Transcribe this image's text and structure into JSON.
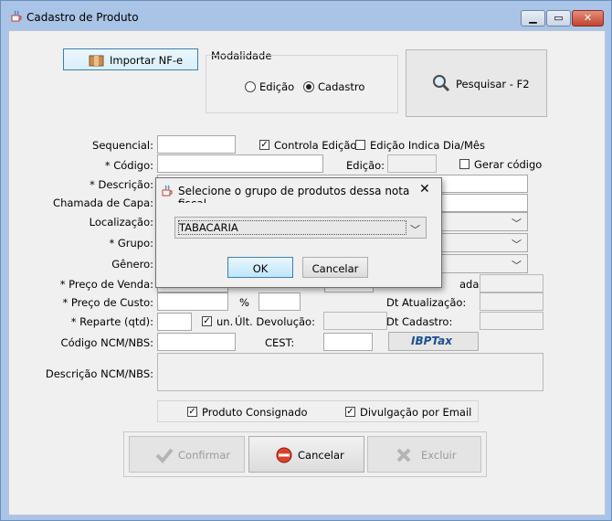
{
  "window": {
    "title": "Cadastro de Produto",
    "icon": "java-cup-icon"
  },
  "top": {
    "import_button": "Importar NF-e",
    "modalidade_label": "Modalidade",
    "radio_edicao": "Edição",
    "radio_cadastro": "Cadastro",
    "selected_mode": "Cadastro",
    "search_button": "Pesquisar - F2"
  },
  "form": {
    "sequencial": "Sequencial:",
    "controla_edicao": "Controla Edição",
    "edicao_indica": "Edição Indica Dia/Mês",
    "codigo": "* Código:",
    "edicao": "Edição:",
    "gerar_codigo": "Gerar código",
    "descricao": "* Descrição:",
    "chamada_capa": "Chamada de Capa:",
    "localizacao": "Localização:",
    "grupo": "* Grupo:",
    "genero": "Gênero:",
    "preco_venda": "* Preço de Venda:",
    "preco_custo": "* Preço de Custo:",
    "percent": "%",
    "reparte": "* Reparte (qtd):",
    "un": "un.",
    "ult_devolucao": "Últ. Devolução:",
    "codigo_ncm": "Código NCM/NBS:",
    "cest": "CEST:",
    "descricao_ncm": "Descrição NCM/NBS:",
    "ultima_entrada_partial": "ada:",
    "dt_atualizacao": "Dt Atualização:",
    "dt_cadastro": "Dt Cadastro:",
    "ibptax": "IBPTax",
    "produto_consignado": "Produto Consignado",
    "divulgacao_email": "Divulgação por Email",
    "controla_edicao_checked": true,
    "edicao_indica_checked": false,
    "gerar_codigo_checked": false,
    "un_checked": true,
    "produto_consignado_checked": true,
    "divulgacao_email_checked": true
  },
  "actions": {
    "confirmar": "Confirmar",
    "cancelar": "Cancelar",
    "excluir": "Excluir"
  },
  "dialog": {
    "title": "Selecione o grupo de produtos dessa nota fiscal",
    "selected": "TABACARIA",
    "ok": "OK",
    "cancel": "Cancelar"
  }
}
